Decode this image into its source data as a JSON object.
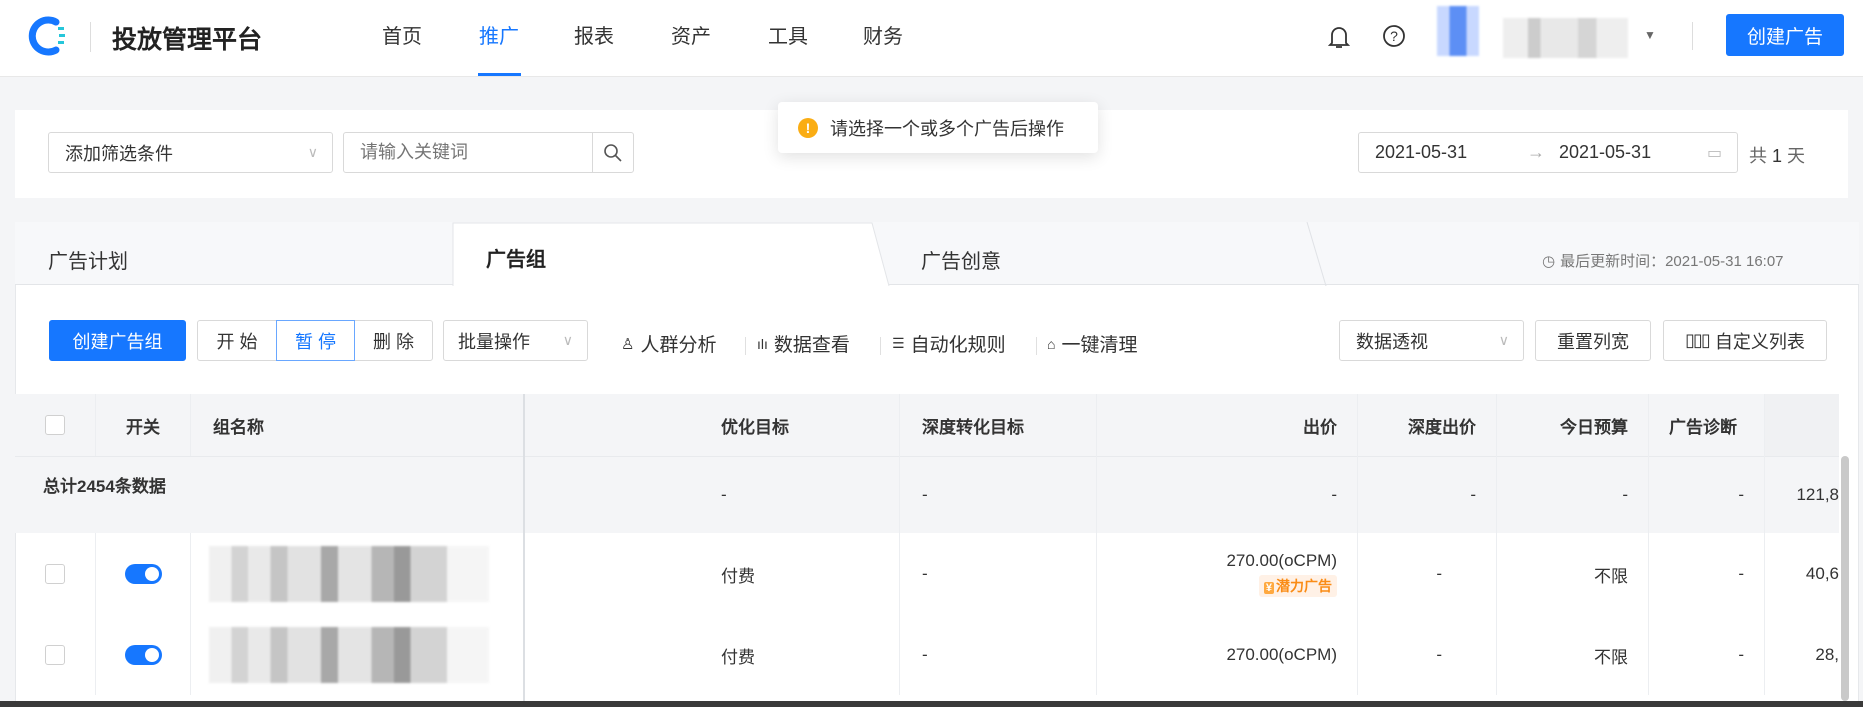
{
  "header": {
    "title": "投放管理平台",
    "nav": [
      "首页",
      "推广",
      "报表",
      "资产",
      "工具",
      "财务"
    ],
    "active_nav": "推广",
    "create_ad": "创建广告"
  },
  "toast": {
    "message": "请选择一个或多个广告后操作"
  },
  "filter": {
    "add_filter": "添加筛选条件",
    "keyword_placeholder": "请输入关键词",
    "date_start": "2021-05-31",
    "date_end": "2021-05-31",
    "total_days_prefix": "共",
    "total_days": "1",
    "total_days_suffix": "天"
  },
  "tabs": {
    "items": [
      "广告计划",
      "广告组",
      "广告创意"
    ],
    "active": "广告组",
    "last_update": "最后更新时间：2021-05-31 16:07"
  },
  "toolbar": {
    "create_group": "创建广告组",
    "start": "开 始",
    "pause": "暂 停",
    "delete": "删 除",
    "batch": "批量操作",
    "audience": "人群分析",
    "data_view": "数据查看",
    "auto_rules": "自动化规则",
    "one_click_clean": "一键清理",
    "data_pivot": "数据透视",
    "reset_width": "重置列宽",
    "custom_columns": "自定义列表"
  },
  "table": {
    "headers": [
      "开关",
      "组名称",
      "",
      "优化目标",
      "深度转化目标",
      "出价",
      "深度出价",
      "今日预算",
      "广告诊断",
      ""
    ],
    "summary": {
      "label": "总计2454条数据",
      "opt": "-",
      "deep": "-",
      "bid": "-",
      "deep_bid": "-",
      "budget": "-",
      "diag": "-",
      "extra": "121,8"
    },
    "rows": [
      {
        "opt": "付费",
        "deep": "-",
        "bid": "270.00(oCPM)",
        "badge": "潜力广告",
        "deep_bid": "-",
        "budget": "不限",
        "diag": "-",
        "extra": "40,6"
      },
      {
        "opt": "付费",
        "deep": "-",
        "bid": "270.00(oCPM)",
        "badge": "",
        "deep_bid": "-",
        "budget": "不限",
        "diag": "-",
        "extra": "28,"
      }
    ]
  },
  "colors": {
    "primary": "#1677ff",
    "warning": "#faad14",
    "badge": "#fa8c16"
  }
}
